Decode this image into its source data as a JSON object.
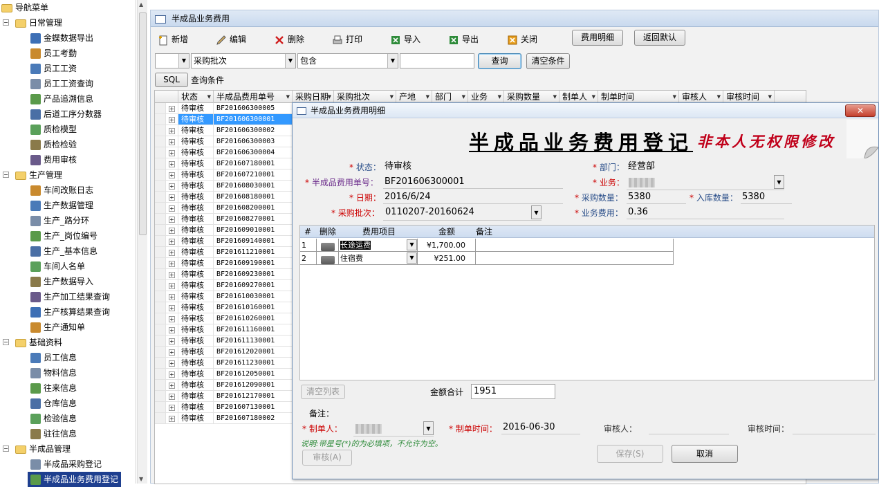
{
  "nav": {
    "root": "导航菜单",
    "groups": [
      {
        "label": "日常管理",
        "items": [
          "金蝶数据导出",
          "员工考勤",
          "员工工资",
          "员工工资查询",
          "产品追溯信息",
          "后道工序分数器",
          "质检模型",
          "质检检验",
          "费用审核"
        ]
      },
      {
        "label": "生产管理",
        "items": [
          "车间改账日志",
          "生产数据管理",
          "生产_路分环",
          "生产_岗位编号",
          "生产_基本信息",
          "车间人名单",
          "生产数据导入",
          "生产加工结果查询",
          "生产核算结果查询",
          "生产通知单"
        ]
      },
      {
        "label": "基础资料",
        "items": [
          "员工信息",
          "物料信息",
          "往来信息",
          "仓库信息",
          "检验信息",
          "驻往信息"
        ]
      },
      {
        "label": "半成品管理",
        "items": [
          "半成品采购登记",
          "半成品业务费用登记"
        ]
      }
    ]
  },
  "window": {
    "title": "半成品业务费用"
  },
  "toolbar": {
    "new": "新增",
    "edit": "编辑",
    "delete": "删除",
    "print": "打印",
    "import": "导入",
    "export": "导出",
    "close": "关闭",
    "detail": "费用明细",
    "reset": "返回默认"
  },
  "filter": {
    "field": "采购批次",
    "op": "包含",
    "value": "",
    "query": "查询",
    "clear": "清空条件",
    "sql": "SQL",
    "sql_label": "查询条件"
  },
  "grid": {
    "columns": [
      "状态",
      "半成品费用单号",
      "采购日期",
      "采购批次",
      "产地",
      "部门",
      "业务",
      "采购数量",
      "制单人",
      "制单时间",
      "审核人",
      "审核时间"
    ],
    "rows": [
      [
        "待审核",
        "BF201606300005"
      ],
      [
        "待审核",
        "BF201606300001"
      ],
      [
        "待审核",
        "BF201606300002"
      ],
      [
        "待审核",
        "BF201606300003"
      ],
      [
        "待审核",
        "BF201606300004"
      ],
      [
        "待审核",
        "BF201607180001"
      ],
      [
        "待审核",
        "BF201607210001"
      ],
      [
        "待审核",
        "BF201608030001"
      ],
      [
        "待审核",
        "BF201608180001"
      ],
      [
        "待审核",
        "BF201608200001"
      ],
      [
        "待审核",
        "BF201608270001"
      ],
      [
        "待审核",
        "BF201609010001"
      ],
      [
        "待审核",
        "BF201609140001"
      ],
      [
        "待审核",
        "BF201611210001"
      ],
      [
        "待审核",
        "BF201609190001"
      ],
      [
        "待审核",
        "BF201609230001"
      ],
      [
        "待审核",
        "BF201609270001"
      ],
      [
        "待审核",
        "BF201610030001"
      ],
      [
        "待审核",
        "BF201610160001"
      ],
      [
        "待审核",
        "BF201610260001"
      ],
      [
        "待审核",
        "BF201611160001"
      ],
      [
        "待审核",
        "BF201611130001"
      ],
      [
        "待审核",
        "BF201612020001"
      ],
      [
        "待审核",
        "BF201611230001"
      ],
      [
        "待审核",
        "BF201612050001"
      ],
      [
        "待审核",
        "BF201612090001"
      ],
      [
        "待审核",
        "BF201612170001"
      ],
      [
        "待审核",
        "BF201607130001"
      ],
      [
        "待审核",
        "BF201607180002"
      ]
    ]
  },
  "dialog": {
    "title": "半成品业务费用明细",
    "banner": "半成品业务费用登记",
    "banner_note": "非本人无权限修改",
    "status_label": "状态：",
    "status": "待审核",
    "no_label": "半成品费用单号：",
    "no": "BF201606300001",
    "date_label": "日期：",
    "date": "2016/6/24",
    "batch_label": "采购批次：",
    "batch": "0110207-20160624",
    "dept_label": "部门：",
    "dept": "经营部",
    "biz_label": "业务：",
    "qty_label": "采购数量：",
    "qty": "5380",
    "in_qty_label": "入库数量：",
    "in_qty": "5380",
    "fee_label": "业务费用：",
    "fee": "0.36",
    "star": "*",
    "detail_cols": [
      "#",
      "删除",
      "费用项目",
      "金额",
      "备注"
    ],
    "detail_rows": [
      {
        "n": "1",
        "item": "长途运费",
        "amount": "¥1,700.00",
        "note": ""
      },
      {
        "n": "2",
        "item": "住宿费",
        "amount": "¥251.00",
        "note": ""
      }
    ],
    "clear_list": "清空列表",
    "total_label": "金额合计",
    "total": "1951",
    "remark_label": "备注：",
    "maker_label": "制单人：",
    "make_time_label": "制单时间：",
    "make_time": "2016-06-30",
    "auditor_label": "审核人：",
    "audit_time_label": "审核时间：",
    "hint": "说明:带星号(*)的为必填项，不允许为空。",
    "audit_btn": "审核(A)",
    "save_btn": "保存(S)",
    "cancel_btn": "取消",
    "close_glyph": "✕"
  }
}
